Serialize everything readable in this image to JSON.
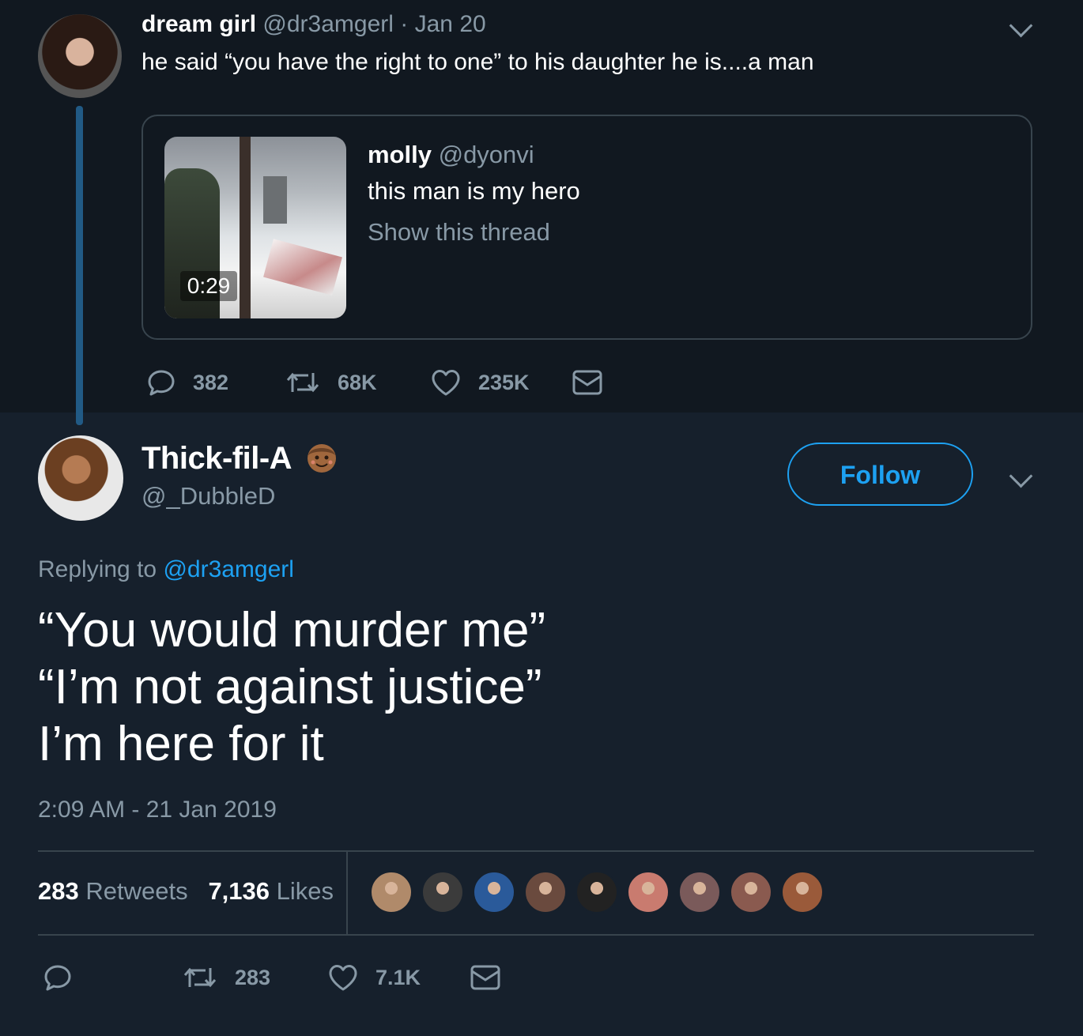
{
  "quoted_parent_tweet": {
    "display_name": "dream girl",
    "handle": "@dr3amgerl",
    "separator": "·",
    "date": "Jan 20",
    "text": "he said “you have the right to one” to his daughter he is....a man",
    "quote": {
      "display_name": "molly",
      "handle": "@dyonvi",
      "text": "this man is my hero",
      "show_thread": "Show this thread",
      "video_duration": "0:29"
    },
    "actions": {
      "replies": "382",
      "retweets": "68K",
      "likes": "235K"
    }
  },
  "main_tweet": {
    "display_name": "Thick-fil-A",
    "handle": "@_DubbleD",
    "follow_label": "Follow",
    "replying_prefix": "Replying to",
    "replying_to": "@dr3amgerl",
    "lines": [
      "“You would murder me”",
      "“I’m not against justice”",
      "I’m here for it"
    ],
    "timestamp": "2:09 AM - 21 Jan 2019",
    "stats": {
      "retweets_count": "283",
      "retweets_label": "Retweets",
      "likes_count": "7,136",
      "likes_label": "Likes"
    },
    "liker_avatar_colors": [
      "#b08a6a",
      "#3b3b3b",
      "#2a5a9a",
      "#6a4a3e",
      "#222222",
      "#c97b6f",
      "#7a5a5a",
      "#8a5a4f",
      "#9a5a3a"
    ],
    "actions": {
      "retweets": "283",
      "likes": "7.1K"
    }
  },
  "icons": {
    "reply": "reply-icon",
    "retweet": "retweet-icon",
    "like": "heart-icon",
    "dm": "envelope-icon",
    "more": "chevron-down-icon"
  },
  "colors": {
    "accent": "#1da1f2",
    "secondary_text": "#8899a6",
    "background": "#16202c",
    "top_background": "#111820",
    "thread_line": "#215a85"
  }
}
